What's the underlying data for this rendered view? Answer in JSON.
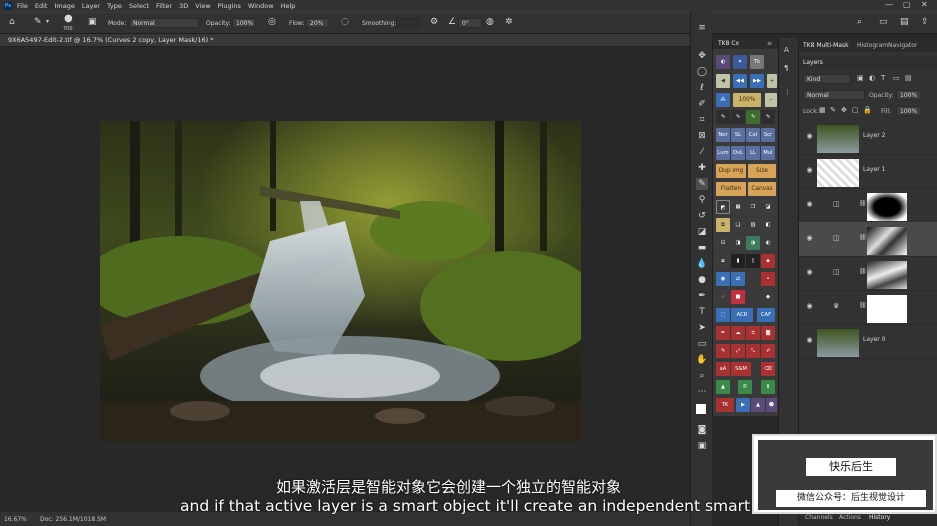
{
  "menu": {
    "items": [
      "File",
      "Edit",
      "Image",
      "Layer",
      "Type",
      "Select",
      "Filter",
      "3D",
      "View",
      "Plugins",
      "Window",
      "Help"
    ]
  },
  "options": {
    "brush_size": "700",
    "mode_label": "Mode:",
    "mode_value": "Normal",
    "opacity_label": "Opacity:",
    "opacity_value": "100%",
    "flow_label": "Flow:",
    "flow_value": "20%",
    "smoothing_label": "Smoothing:",
    "angle_value": "0°"
  },
  "document": {
    "tab_title": "9X6A5497-Edit-2.tif @ 16.7% (Curves 2 copy, Layer Mask/16) *",
    "zoom": "16.67%",
    "doc_info": "Doc: 256.1M/1018.5M"
  },
  "tk_panel": {
    "title": "TK8 Cx",
    "buttons_row_text": [
      "100%"
    ],
    "nor": "Nor",
    "sl": "SL",
    "col": "Col",
    "scr": "Scr",
    "lum": "Lum",
    "ovl": "OvL",
    "ll": "LL",
    "mul": "Mul",
    "dup_img": "Dup img",
    "size": "Size",
    "flatten": "Flatten",
    "canvas": "Canvas",
    "acr": "ACR",
    "caf": "CAF",
    "sm": "S&M",
    "tk": "TK"
  },
  "right_panel": {
    "tab_multimask": "TK8 Multi-Mask",
    "tab_histogram": "Histogram",
    "tab_navigator": "Navigator",
    "tab_layers": "Layers",
    "kind_label": "Kind",
    "blend_mode": "Normal",
    "opacity_label": "Opacity:",
    "opacity_value": "100%",
    "lock_label": "Lock:",
    "fill_label": "Fill:",
    "fill_value": "100%",
    "layers": [
      "Layer 2",
      "Layer 1",
      "",
      "",
      "",
      "",
      "Layer 0"
    ],
    "tab_channels": "Channels",
    "tab_actions": "Actions",
    "tab_history": "History"
  },
  "subtitles": {
    "chinese": "如果激活层是智能对象它会创建一个独立的智能对象",
    "english": "and if that active layer is a smart object it'll create an independent smart"
  },
  "watermark": {
    "line1": "快乐后生",
    "line2": "微信公众号：后生视觉设计"
  }
}
